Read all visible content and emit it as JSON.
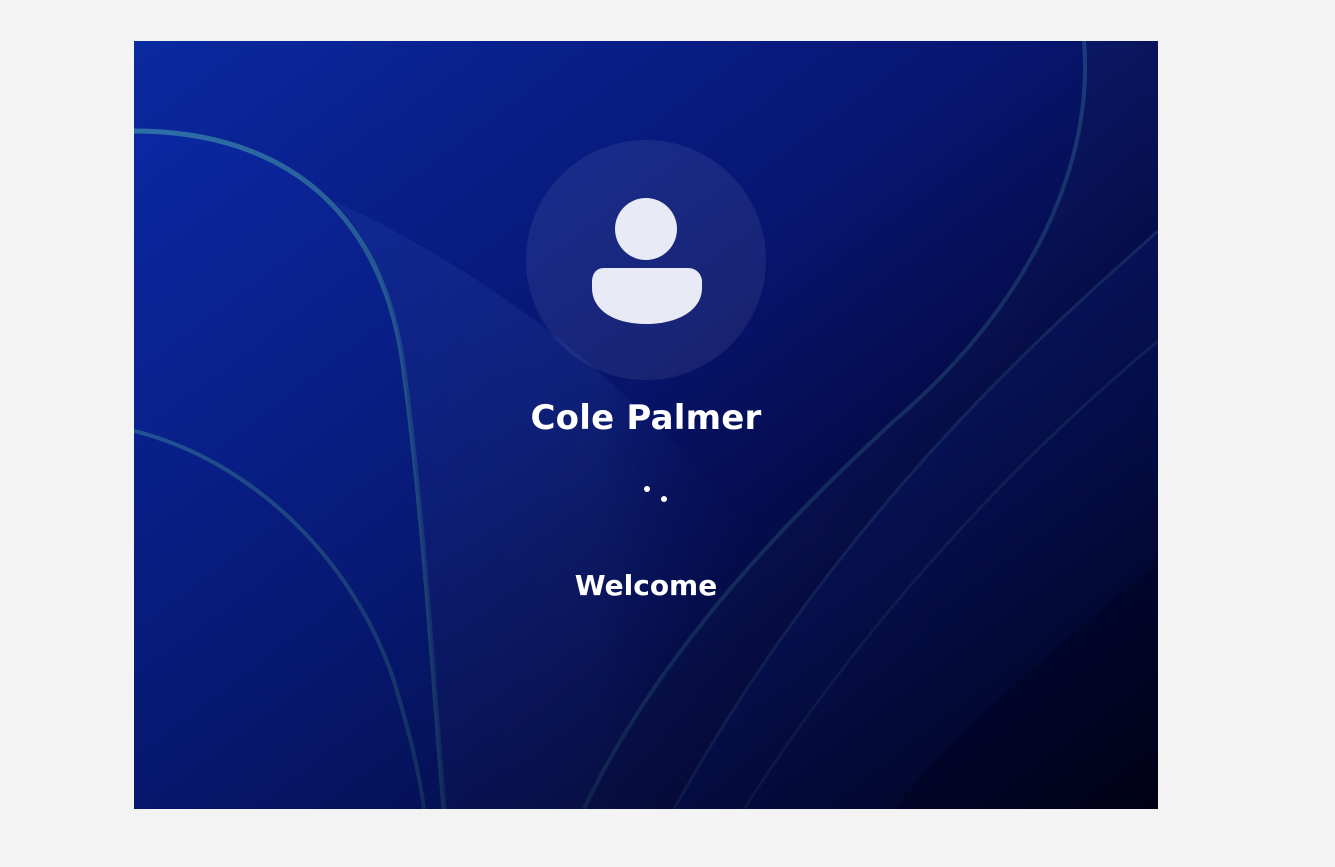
{
  "lock_screen": {
    "user_name": "Cole Palmer",
    "status_text": "Welcome",
    "avatar_icon": "person-icon",
    "spinner_icon": "loading-spinner-icon"
  },
  "colors": {
    "page_background": "#f3f3f3",
    "wallpaper_base": "#0a1f96",
    "text": "#ffffff"
  }
}
